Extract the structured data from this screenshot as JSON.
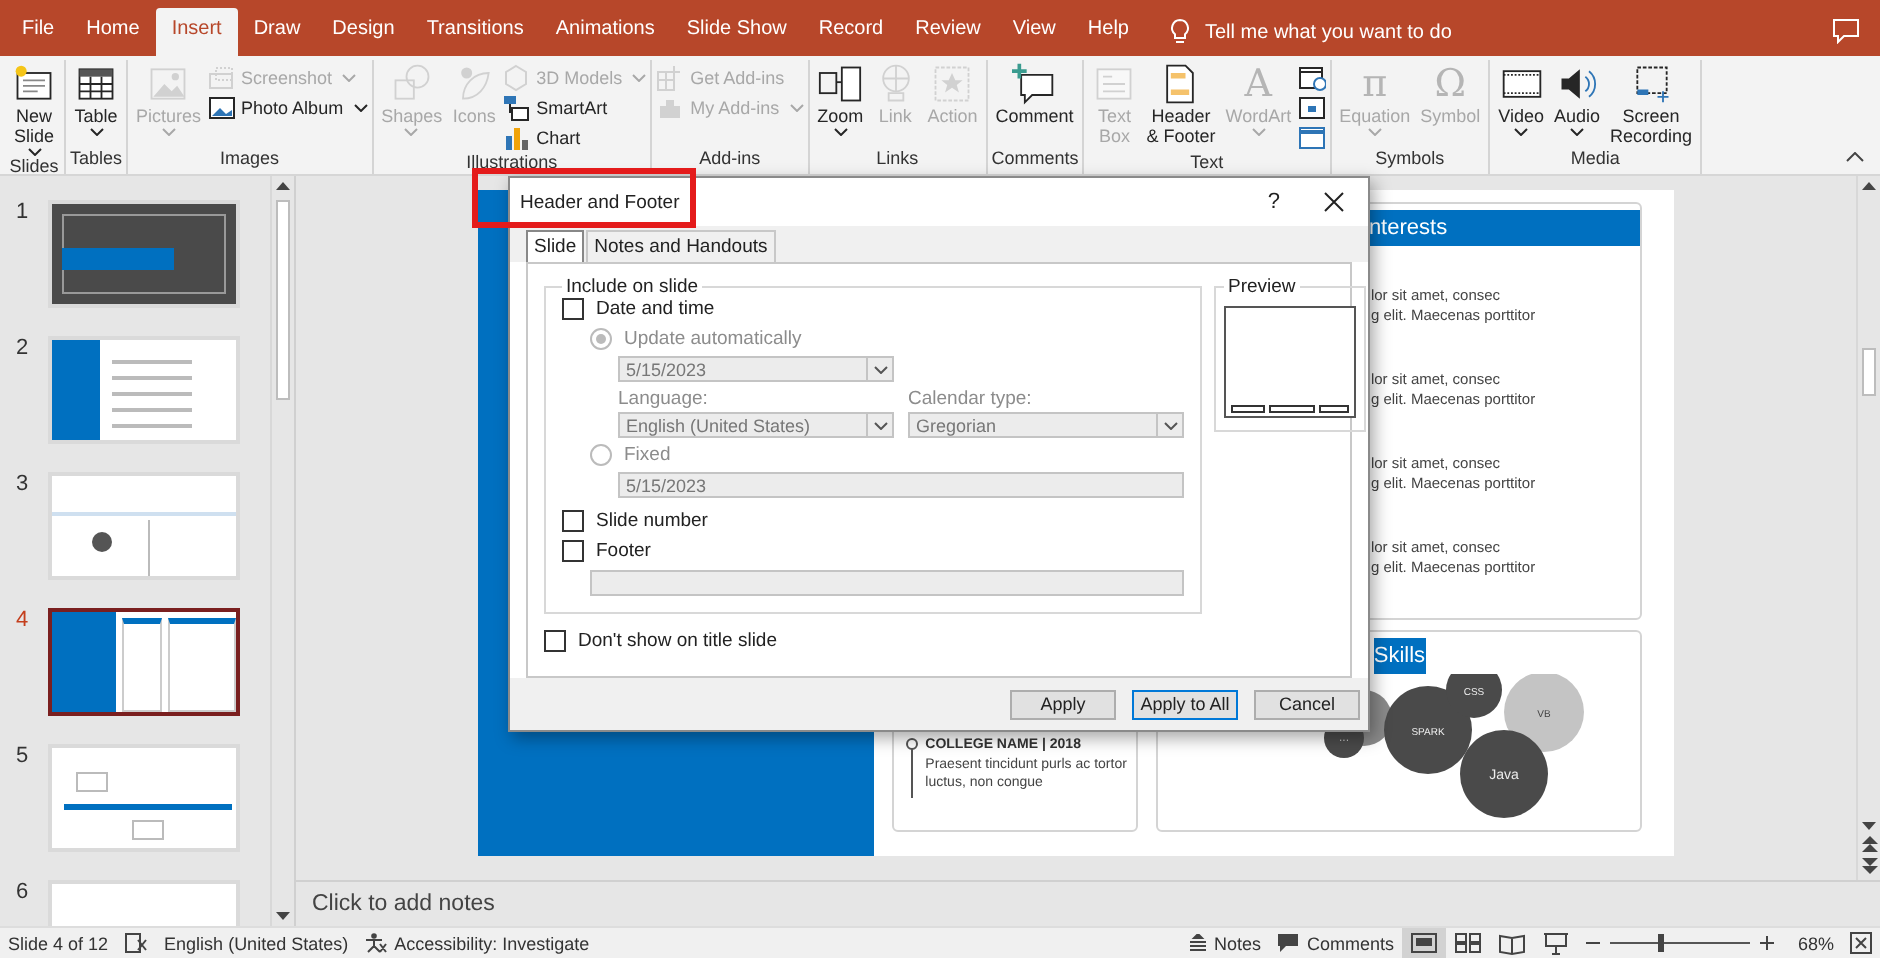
{
  "tabs": [
    {
      "label": "File",
      "selected": false
    },
    {
      "label": "Home",
      "selected": false
    },
    {
      "label": "Insert",
      "selected": true
    },
    {
      "label": "Draw",
      "selected": false
    },
    {
      "label": "Design",
      "selected": false
    },
    {
      "label": "Transitions",
      "selected": false
    },
    {
      "label": "Animations",
      "selected": false
    },
    {
      "label": "Slide Show",
      "selected": false
    },
    {
      "label": "Record",
      "selected": false
    },
    {
      "label": "Review",
      "selected": false
    },
    {
      "label": "View",
      "selected": false
    },
    {
      "label": "Help",
      "selected": false
    }
  ],
  "tell_me": {
    "placeholder": "Tell me what you want to do"
  },
  "ribbon": {
    "groups": [
      {
        "label": "Slides",
        "items": [
          {
            "kind": "large",
            "label": "New\nSlide",
            "menu": true,
            "disabled": false
          }
        ]
      },
      {
        "label": "Tables",
        "items": [
          {
            "kind": "large",
            "label": "Table",
            "menu": true,
            "disabled": false
          }
        ]
      },
      {
        "label": "Images",
        "items": [
          {
            "kind": "large",
            "label": "Pictures",
            "menu": true,
            "disabled": true
          },
          {
            "kind": "small",
            "label": "Screenshot",
            "menu": true,
            "disabled": true
          },
          {
            "kind": "small",
            "label": "Photo Album",
            "menu": true,
            "disabled": false
          }
        ]
      },
      {
        "label": "Illustrations",
        "items": [
          {
            "kind": "large",
            "label": "Shapes",
            "menu": true,
            "disabled": true
          },
          {
            "kind": "large",
            "label": "Icons",
            "menu": false,
            "disabled": true
          },
          {
            "kind": "small",
            "label": "3D Models",
            "menu": true,
            "disabled": true
          },
          {
            "kind": "small",
            "label": "SmartArt",
            "menu": false,
            "disabled": false
          },
          {
            "kind": "small",
            "label": "Chart",
            "menu": false,
            "disabled": false
          }
        ]
      },
      {
        "label": "Add-ins",
        "items": [
          {
            "kind": "small",
            "label": "Get Add-ins",
            "menu": false,
            "disabled": true
          },
          {
            "kind": "small",
            "label": "My Add-ins",
            "menu": true,
            "disabled": true
          }
        ]
      },
      {
        "label": "Links",
        "items": [
          {
            "kind": "large",
            "label": "Zoom",
            "menu": true,
            "disabled": false
          },
          {
            "kind": "large",
            "label": "Link",
            "menu": false,
            "disabled": true
          },
          {
            "kind": "large",
            "label": "Action",
            "menu": false,
            "disabled": true
          }
        ]
      },
      {
        "label": "Comments",
        "items": [
          {
            "kind": "large",
            "label": "Comment",
            "menu": false,
            "disabled": false
          }
        ]
      },
      {
        "label": "Text",
        "items": [
          {
            "kind": "large",
            "label": "Text\nBox",
            "menu": false,
            "disabled": true
          },
          {
            "kind": "large",
            "label": "Header\n& Footer",
            "menu": false,
            "disabled": false
          },
          {
            "kind": "large",
            "label": "WordArt",
            "glyph": "A",
            "menu": true,
            "disabled": true
          },
          {
            "kind": "icon",
            "disabled": false
          },
          {
            "kind": "icon",
            "disabled": false
          },
          {
            "kind": "icon",
            "disabled": false
          }
        ]
      },
      {
        "label": "Symbols",
        "items": [
          {
            "kind": "large",
            "label": "Equation",
            "glyph": "π",
            "menu": true,
            "disabled": true
          },
          {
            "kind": "large",
            "label": "Symbol",
            "glyph": "Ω",
            "menu": false,
            "disabled": true
          }
        ]
      },
      {
        "label": "Media",
        "items": [
          {
            "kind": "large",
            "label": "Video",
            "menu": true,
            "disabled": false
          },
          {
            "kind": "large",
            "label": "Audio",
            "menu": true,
            "disabled": false
          },
          {
            "kind": "large",
            "label": "Screen\nRecording",
            "menu": false,
            "disabled": false
          }
        ]
      }
    ]
  },
  "slides": [
    {
      "number": "1",
      "selected": false
    },
    {
      "number": "2",
      "selected": false
    },
    {
      "number": "3",
      "selected": false
    },
    {
      "number": "4",
      "selected": true
    },
    {
      "number": "5",
      "selected": false
    },
    {
      "number": "6",
      "selected": false
    }
  ],
  "slide": {
    "college": {
      "title": "COLLEGE NAME | 2018",
      "text": "Praesent tincidunt purls ac tortor luctus, non congue"
    },
    "interests": {
      "title": "nterests",
      "entries": [
        {
          "line_1": "lor sit amet, consec",
          "line_2": "g elit. Maecenas porttitor"
        },
        {
          "line_1": "lor sit amet, consec",
          "line_2": "g elit. Maecenas porttitor"
        },
        {
          "line_1": "lor sit amet, consec",
          "line_2": "g elit. Maecenas porttitor"
        },
        {
          "line_1": "lor sit amet, consec",
          "line_2": "g elit. Maecenas porttitor"
        }
      ]
    },
    "skills": {
      "title": "Skills",
      "bubbles": [
        {
          "color": "#8a8a8a"
        },
        {
          "label": "SPARK",
          "color": "#4a4a4a"
        },
        {
          "label": "CSS",
          "color": "#4a4a4a"
        },
        {
          "label": "VB",
          "color": "#c4c4c4"
        },
        {
          "label": "Java",
          "color": "#4a4a4a"
        },
        {
          "label": "···",
          "color": "#4a4a4a"
        }
      ]
    }
  },
  "notes": {
    "placeholder": "Click to add notes"
  },
  "dialog": {
    "title": "Header and Footer",
    "help": "?",
    "tabs": [
      {
        "label": "Slide",
        "selected": true
      },
      {
        "label": "Notes and Handouts",
        "selected": false
      }
    ],
    "include": {
      "legend": "Include on slide",
      "date_time": {
        "label": "Date and time",
        "checked": false
      },
      "update_auto": {
        "label": "Update automatically",
        "selected": true,
        "disabled": true
      },
      "date_dropdown": {
        "value": "5/15/2023",
        "disabled": true
      },
      "language": {
        "label": "Language:",
        "value": "English (United States)",
        "disabled": true
      },
      "calendar": {
        "label": "Calendar type:",
        "value": "Gregorian",
        "disabled": true
      },
      "fixed": {
        "label": "Fixed",
        "selected": false,
        "disabled": true
      },
      "fixed_field": {
        "value": "5/15/2023",
        "disabled": true
      },
      "slide_number": {
        "label": "Slide number",
        "checked": false
      },
      "footer": {
        "label": "Footer",
        "checked": false
      },
      "footer_field": {
        "disabled": true
      }
    },
    "preview": {
      "legend": "Preview"
    },
    "title_slide": {
      "label": "Don't show on title slide",
      "checked": false
    },
    "buttons": [
      {
        "label": "Apply",
        "default": false
      },
      {
        "label": "Apply to All",
        "default": true
      },
      {
        "label": "Cancel",
        "default": false
      }
    ]
  },
  "annotation": {
    "kind": "frame",
    "color": "#e41b1b"
  },
  "status_bar": {
    "slide": "Slide 4 of 12",
    "language": "English (United States)",
    "accessibility": "Accessibility: Investigate",
    "notes": "Notes",
    "comments": "Comments",
    "views": [
      {
        "selected": true
      },
      {
        "selected": false
      },
      {
        "selected": false
      },
      {
        "selected": false
      }
    ],
    "zoom": {
      "level": 0.35,
      "reading": "68%"
    }
  }
}
